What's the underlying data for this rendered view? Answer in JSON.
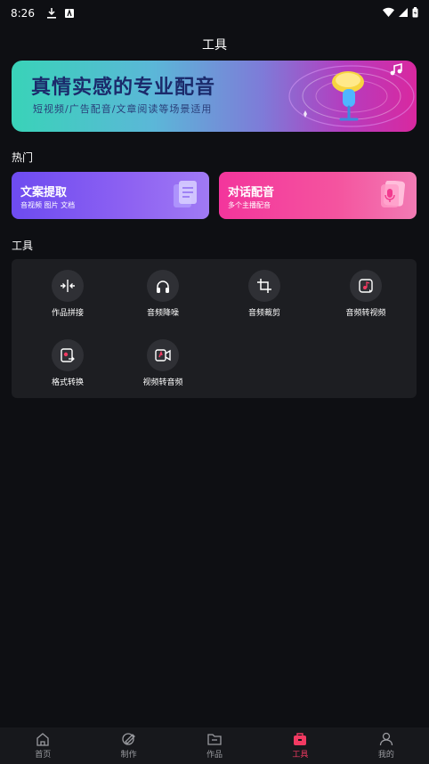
{
  "status_bar": {
    "time": "8:26"
  },
  "header": {
    "title": "工具"
  },
  "banner": {
    "headline": "真情实感的专业配音",
    "subtitle": "短视频/广告配音/文章阅读等场景适用"
  },
  "hot": {
    "section_label": "热门",
    "cards": [
      {
        "title": "文案提取",
        "desc": "音视频 图片 文档"
      },
      {
        "title": "对话配音",
        "desc": "多个主播配音"
      }
    ]
  },
  "tools": {
    "section_label": "工具",
    "items": [
      {
        "label": "作品拼接",
        "icon": "merge-icon"
      },
      {
        "label": "音频降噪",
        "icon": "headphones-icon"
      },
      {
        "label": "音频裁剪",
        "icon": "crop-icon"
      },
      {
        "label": "音频转视频",
        "icon": "audio-to-video-icon"
      },
      {
        "label": "格式转换",
        "icon": "format-convert-icon"
      },
      {
        "label": "视频转音频",
        "icon": "video-to-audio-icon"
      }
    ]
  },
  "bottom_nav": {
    "items": [
      {
        "label": "首页",
        "icon": "home-icon"
      },
      {
        "label": "制作",
        "icon": "create-icon"
      },
      {
        "label": "作品",
        "icon": "folder-icon"
      },
      {
        "label": "工具",
        "icon": "toolbox-icon"
      },
      {
        "label": "我的",
        "icon": "profile-icon"
      }
    ],
    "active": "工具"
  },
  "colors": {
    "background": "#0e0f13",
    "panel": "#1d1e22",
    "accent": "#f23a62",
    "extract_card": "#7a56f2",
    "dialog_card": "#f4479f"
  }
}
